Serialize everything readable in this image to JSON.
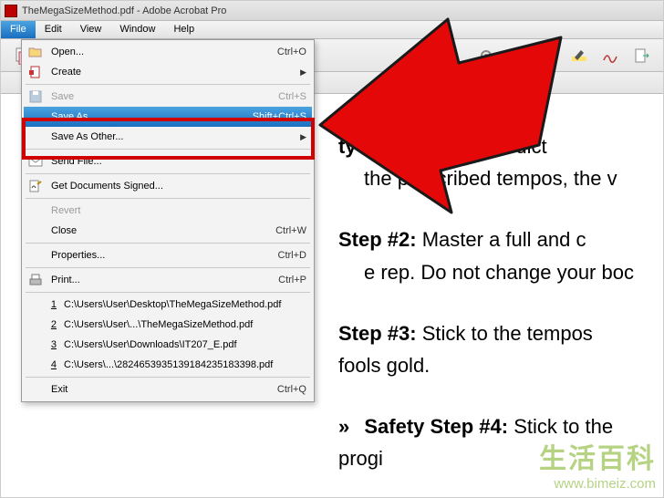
{
  "title": "TheMegaSizeMethod.pdf - Adobe Acrobat Pro",
  "menubar": {
    "items": [
      {
        "label": "File",
        "active": true
      },
      {
        "label": "Edit"
      },
      {
        "label": "View"
      },
      {
        "label": "Window"
      },
      {
        "label": "Help"
      }
    ]
  },
  "dropdown": [
    {
      "type": "item",
      "label": "Open...",
      "accel": "Ctrl+O",
      "icon": "open-folder-icon"
    },
    {
      "type": "item",
      "label": "Create",
      "submenu": true,
      "icon": "create-icon"
    },
    {
      "type": "sep"
    },
    {
      "type": "item",
      "label": "Save",
      "accel": "Ctrl+S",
      "disabled": true,
      "icon": "save-icon"
    },
    {
      "type": "item",
      "label": "Save As...",
      "accel": "Shift+Ctrl+S",
      "selected": true
    },
    {
      "type": "item",
      "label": "Save As Other...",
      "submenu": true
    },
    {
      "type": "sep"
    },
    {
      "type": "item",
      "label": "Send File...",
      "icon": "send-icon"
    },
    {
      "type": "sep"
    },
    {
      "type": "item",
      "label": "Get Documents Signed...",
      "icon": "sign-icon"
    },
    {
      "type": "sep"
    },
    {
      "type": "item",
      "label": "Revert",
      "disabled": true
    },
    {
      "type": "item",
      "label": "Close",
      "accel": "Ctrl+W"
    },
    {
      "type": "sep"
    },
    {
      "type": "item",
      "label": "Properties...",
      "accel": "Ctrl+D"
    },
    {
      "type": "sep"
    },
    {
      "type": "item",
      "label": "Print...",
      "accel": "Ctrl+P",
      "icon": "print-icon"
    },
    {
      "type": "sep"
    },
    {
      "type": "recent",
      "num": "1",
      "label": "C:\\Users\\User\\Desktop\\TheMegaSizeMethod.pdf"
    },
    {
      "type": "recent",
      "num": "2",
      "label": "C:\\Users\\User\\...\\TheMegaSizeMethod.pdf"
    },
    {
      "type": "recent",
      "num": "3",
      "label": "C:\\Users\\User\\Downloads\\IT207_E.pdf"
    },
    {
      "type": "recent",
      "num": "4",
      "label": "C:\\Users\\...\\2824653935139184235183398.pdf"
    },
    {
      "type": "sep"
    },
    {
      "type": "item",
      "label": "Exit",
      "accel": "Ctrl+Q"
    }
  ],
  "toolbar_icons": [
    "create-tool-icon",
    "open-tool-icon",
    "save-tool-icon",
    "print-tool-icon",
    "mail-tool-icon",
    "comment-tool-icon",
    "highlight-tool-icon",
    "signature-tool-icon",
    "export-tool-icon"
  ],
  "page_body": {
    "step1": {
      "label": "ty Step #",
      "body_a": "e tempos dict",
      "sub": "the prescribed tempos, the v"
    },
    "step2": {
      "label": "Step #2:",
      "body": "Master a full and c",
      "sub": "e rep. Do not change your boc"
    },
    "step3": {
      "label": "Step #3:",
      "body": "Stick to the tempos",
      "sub": "fools gold."
    },
    "step4": {
      "bullet": "»",
      "label": "Safety Step #4:",
      "body": "Stick to the progi"
    }
  },
  "watermark": {
    "line1": "生活百科",
    "line2": "www.bimeiz.com"
  },
  "colors": {
    "highlight_red": "#d10000",
    "arrow_fill": "#e40808",
    "arrow_stroke": "#1a1a1a",
    "menu_selected": "#1a6fc0"
  }
}
